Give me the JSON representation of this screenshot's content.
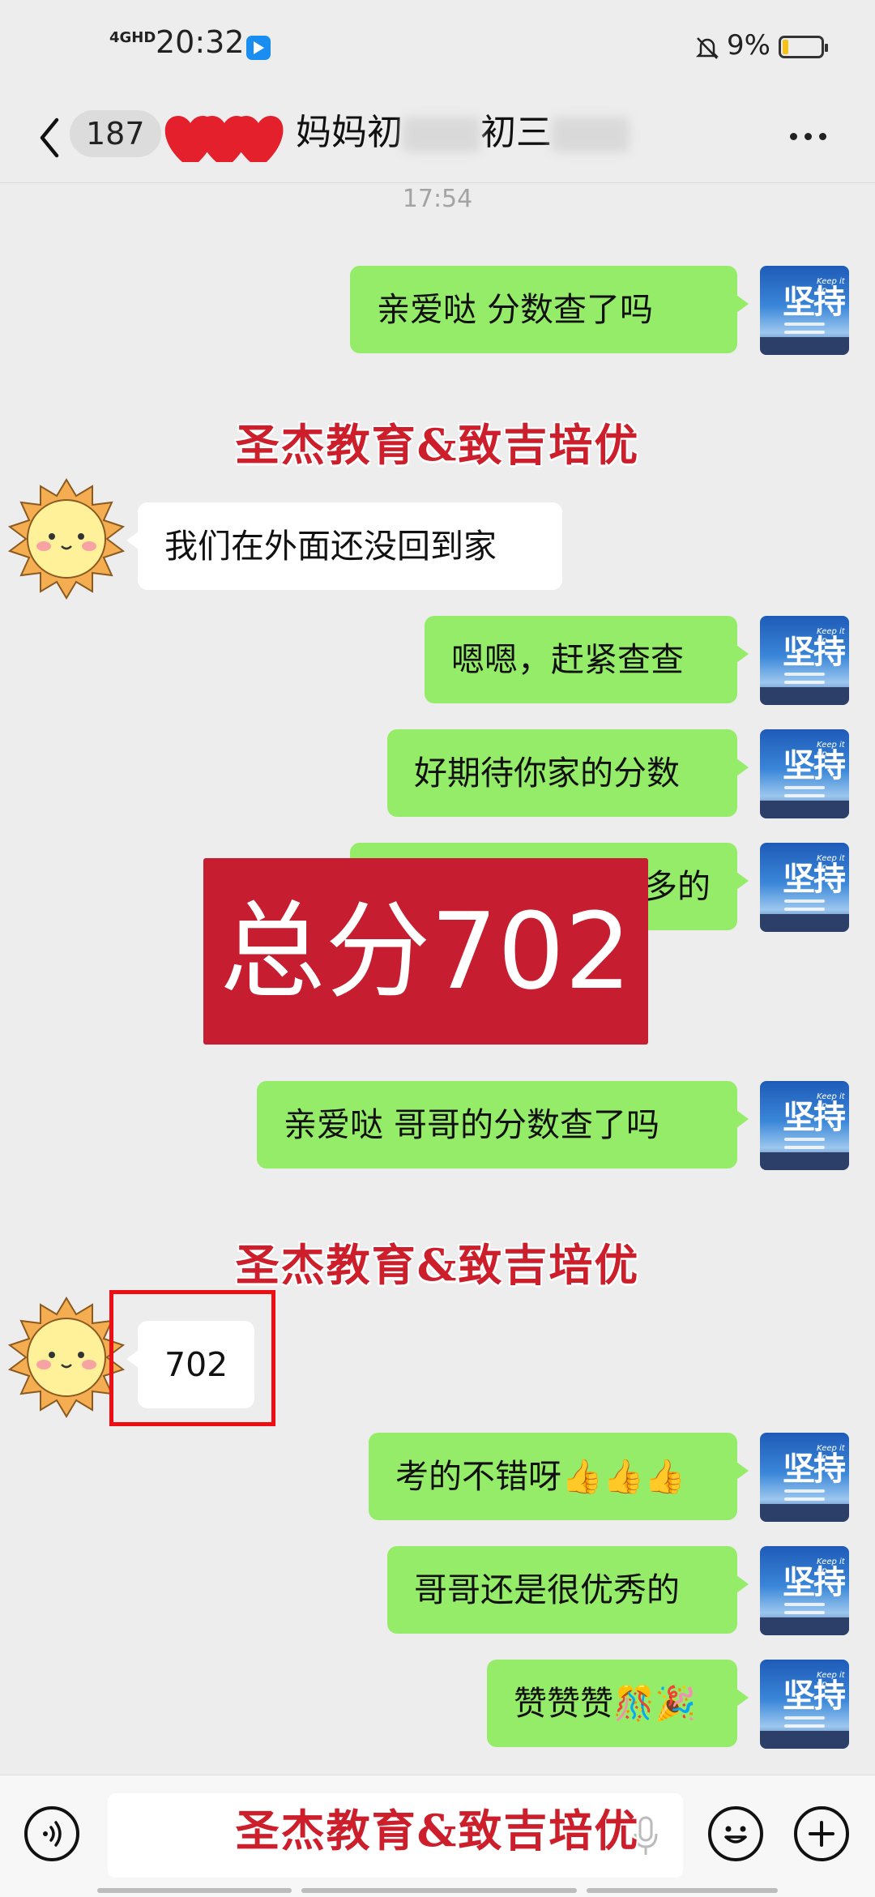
{
  "status_bar": {
    "network": "4GHD",
    "time": "20:32",
    "battery_percent": "9%"
  },
  "header": {
    "unread_count": "187",
    "title_part1": "妈妈初",
    "title_part2": "初三",
    "more_icon": "more-dots-icon"
  },
  "watermark": "圣杰教育&致吉培优",
  "score_banner": "总分702",
  "timestamps": [
    "17:54"
  ],
  "messages": [
    {
      "side": "me",
      "text": "亲爱哒    分数查了吗"
    },
    {
      "side": "them",
      "text": "我们在外面还没回到家"
    },
    {
      "side": "me",
      "text": "嗯嗯，赶紧查查"
    },
    {
      "side": "me",
      "text": "好期待你家的分数"
    },
    {
      "side": "me",
      "text": "多的"
    },
    {
      "side": "me",
      "text": "亲爱哒  哥哥的分数查了吗"
    },
    {
      "side": "them",
      "text": "702"
    },
    {
      "side": "me",
      "text": "考的不错呀👍👍👍"
    },
    {
      "side": "me",
      "text": "哥哥还是很优秀的"
    },
    {
      "side": "me",
      "text": "赞赞赞🎊🎉"
    }
  ],
  "input_bar": {
    "voice_icon": "voice-icon",
    "mic_icon": "mic-icon",
    "emoji_icon": "emoji-icon",
    "plus_icon": "plus-icon"
  },
  "colors": {
    "me_bubble": "#95ec69",
    "them_bubble": "#ffffff",
    "background": "#ededed",
    "banner": "#c61e30",
    "watermark": "#cc1e2b",
    "highlight_box": "#ee0d12"
  }
}
